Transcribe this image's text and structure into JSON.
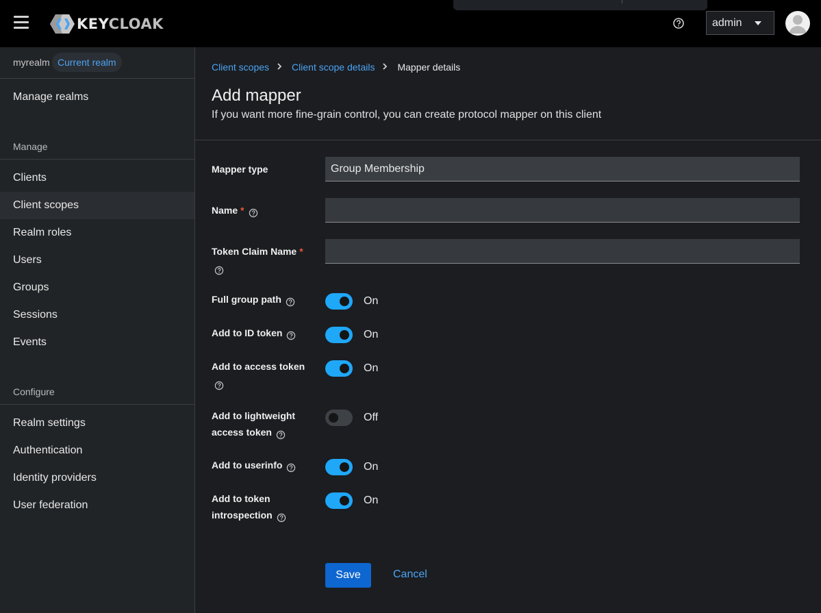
{
  "header": {
    "logo_primary": "KEY",
    "logo_secondary": "CLOAK",
    "user_name": "admin",
    "icons": [
      "menu-icon",
      "help-icon",
      "caret-down-icon",
      "user-avatar"
    ]
  },
  "sidebar": {
    "realm_name": "myrealm",
    "realm_badge": "Current realm",
    "manage_realms": "Manage realms",
    "manage_section": "Manage",
    "manage_items": [
      "Clients",
      "Client scopes",
      "Realm roles",
      "Users",
      "Groups",
      "Sessions",
      "Events"
    ],
    "configure_section": "Configure",
    "configure_items": [
      "Realm settings",
      "Authentication",
      "Identity providers",
      "User federation"
    ],
    "active_item": "Client scopes"
  },
  "breadcrumb": [
    "Client scopes",
    "Client scope details",
    "Mapper details"
  ],
  "page": {
    "title": "Add mapper",
    "description": "If you want more fine-grain control, you can create protocol mapper on this client"
  },
  "form": {
    "mapper_type_label": "Mapper type",
    "mapper_type_value": "Group Membership",
    "name_label": "Name",
    "name_value": "",
    "token_claim_label": "Token Claim Name",
    "token_claim_value": "",
    "required_mark": "*",
    "toggles": [
      {
        "label": "Full group path",
        "state": "On"
      },
      {
        "label": "Add to ID token",
        "state": "On"
      },
      {
        "label": "Add to access token",
        "state": "On"
      },
      {
        "label": "Add to lightweight access token",
        "state": "Off"
      },
      {
        "label": "Add to userinfo",
        "state": "On"
      },
      {
        "label": "Add to token introspection",
        "state": "On"
      }
    ],
    "save_label": "Save",
    "cancel_label": "Cancel"
  },
  "colors": {
    "accent": "#4da3f2",
    "toggle_on": "#1fa7f8",
    "primary_button": "#0e66d0",
    "required": "#e8563a"
  }
}
